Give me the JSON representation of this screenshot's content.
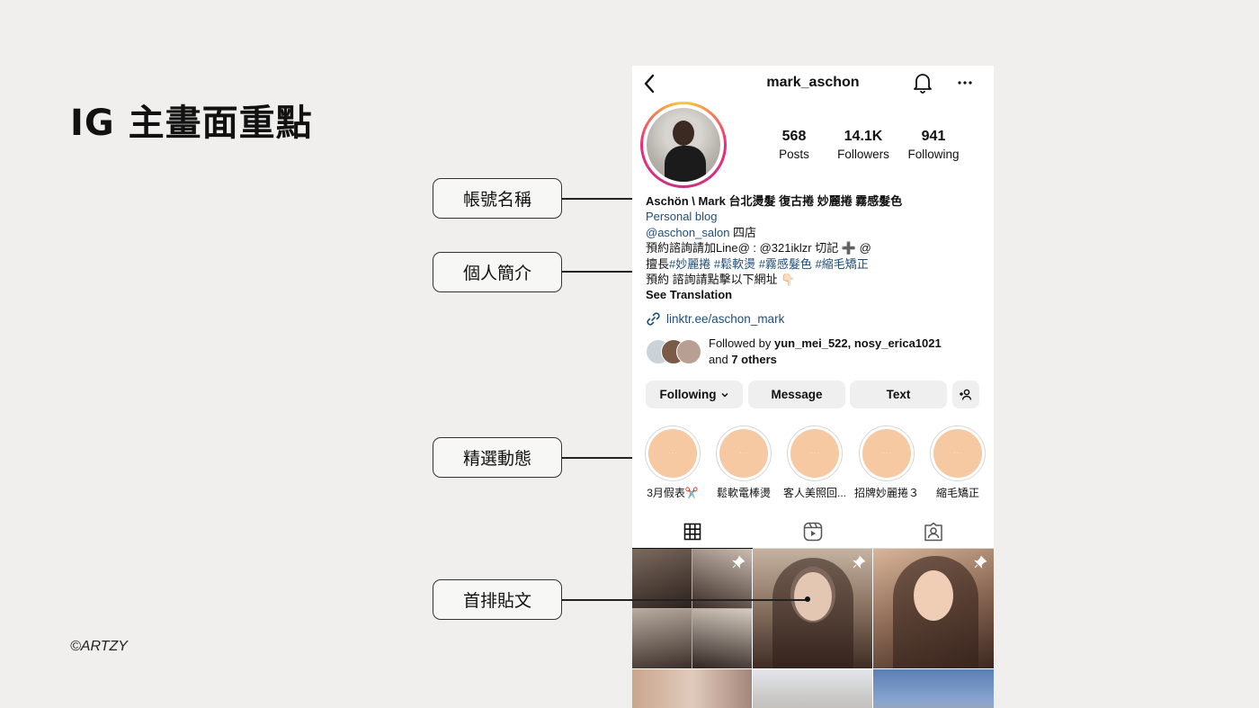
{
  "slide": {
    "title": "IG 主畫面重點",
    "credit": "©ARTZY",
    "callouts": [
      "帳號名稱",
      "個人簡介",
      "精選動態",
      "首排貼文"
    ]
  },
  "profile": {
    "username": "mark_aschon",
    "stats": [
      {
        "value": "568",
        "label": "Posts"
      },
      {
        "value": "14.1K",
        "label": "Followers"
      },
      {
        "value": "941",
        "label": "Following"
      }
    ],
    "display_name": "Aschön \\ Mark 台北燙髮 復古捲 妙麗捲 霧感髮色",
    "category": "Personal blog",
    "bio_mention": "@aschon_salon",
    "bio_mention_suffix": " 四店",
    "bio_line3": "預約諮詢請加Line@ : @321iklzr 切記 ➕ @",
    "bio_line4_prefix": "擅長",
    "bio_line4_tags": "#妙麗捲 #鬆軟燙 #霧感髮色 #縮毛矯正",
    "bio_line5": "預約 諮詢請點擊以下網址 👇🏻",
    "see_translation": "See Translation",
    "website": "linktr.ee/aschon_mark",
    "followed_by_prefix": "Followed by ",
    "followed_by_names": "yun_mei_522, nosy_erica1021",
    "followed_by_and": "and ",
    "followed_by_others": "7 others"
  },
  "buttons": {
    "following": "Following",
    "message": "Message",
    "text": "Text"
  },
  "highlights": [
    {
      "label": "3月假表✂️"
    },
    {
      "label": "鬆軟電棒燙"
    },
    {
      "label": "客人美照回..."
    },
    {
      "label": "招牌妙麗捲３"
    },
    {
      "label": "縮毛矯正"
    }
  ],
  "icons": {
    "back": "chevron-left-icon",
    "bell": "bell-icon",
    "more": "more-horizontal-icon",
    "link": "link-icon",
    "grid": "grid-icon",
    "reels": "reels-icon",
    "tagged": "tagged-icon",
    "pin": "pin-icon",
    "add_person": "add-person-icon"
  },
  "colors": {
    "link": "#1f4e79",
    "highlight_fill": "#f6c9a3",
    "story_ring": "#ee2a7b",
    "button_bg": "#efefef"
  }
}
